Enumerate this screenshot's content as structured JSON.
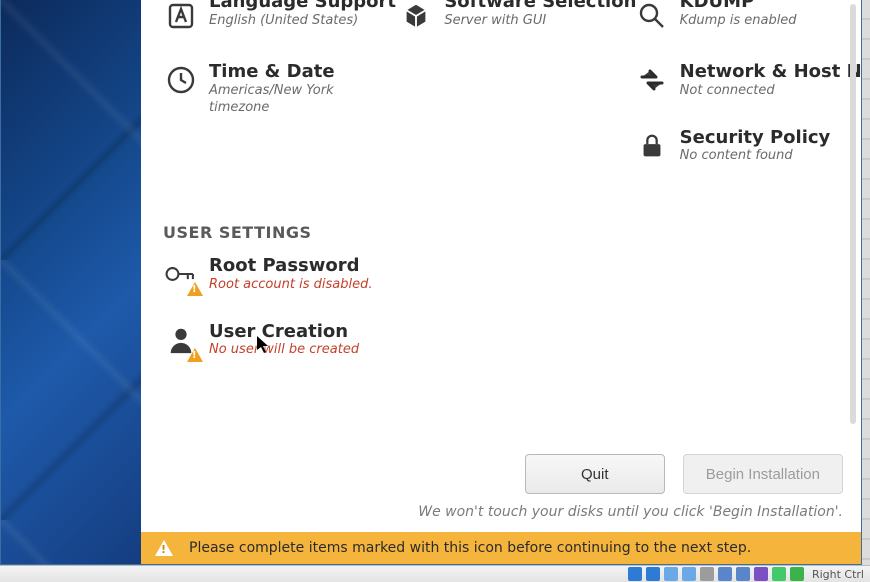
{
  "system": {
    "language": {
      "title": "Language Support",
      "sub": "English (United States)"
    },
    "software": {
      "title": "Software Selection",
      "sub": "Server with GUI"
    },
    "kdump": {
      "title": "KDUMP",
      "sub": "Kdump is enabled"
    },
    "time": {
      "title": "Time & Date",
      "sub": "Americas/New York timezone"
    },
    "network": {
      "title": "Network & Host N",
      "sub": "Not connected"
    },
    "security": {
      "title": "Security Policy",
      "sub": "No content found"
    }
  },
  "user_settings_header": "USER SETTINGS",
  "user": {
    "root": {
      "title": "Root Password",
      "sub": "Root account is disabled."
    },
    "create": {
      "title": "User Creation",
      "sub": "No user will be created"
    }
  },
  "buttons": {
    "quit": "Quit",
    "begin": "Begin Installation"
  },
  "hint": "We won't touch your disks until you click 'Begin Installation'.",
  "warning_bar": "Please complete items marked with this icon before continuing to the next step.",
  "vbox": {
    "host_key": "Right Ctrl"
  }
}
